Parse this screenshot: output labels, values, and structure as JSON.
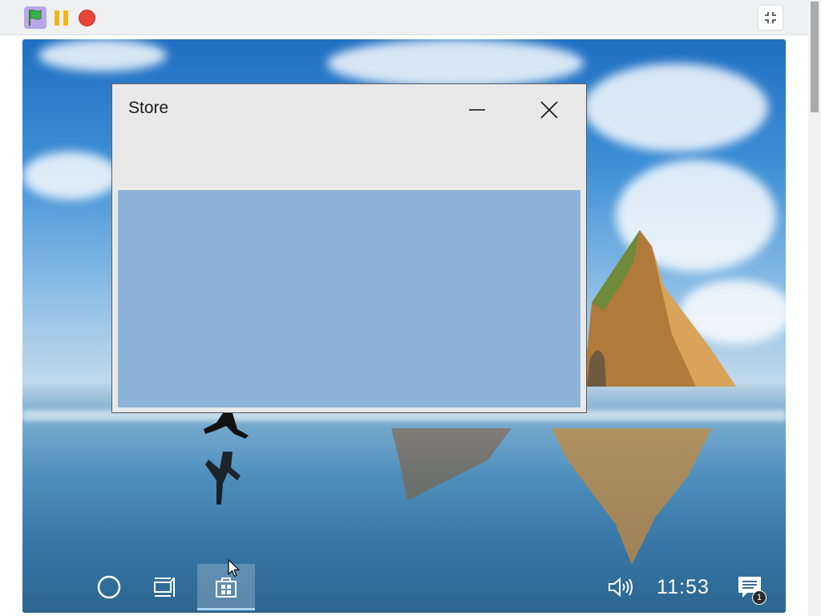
{
  "toolbar": {
    "flag_icon": "green-flag-icon",
    "pause_icon": "pause-icon",
    "stop_icon": "stop-icon",
    "shrink_icon": "exit-fullscreen-icon"
  },
  "window": {
    "title": "Store",
    "minimize_icon": "minimize-icon",
    "close_icon": "close-icon",
    "content_color": "#8db2d6"
  },
  "taskbar": {
    "cortana_icon": "cortana-circle-icon",
    "taskview_icon": "task-view-icon",
    "store_icon": "store-icon",
    "volume_icon": "volume-icon",
    "clock": "11:53",
    "notification_icon": "action-center-icon",
    "notification_count": "1"
  },
  "colors": {
    "accent": "#a9d4f5",
    "topbar_bg": "#eef0f2"
  }
}
